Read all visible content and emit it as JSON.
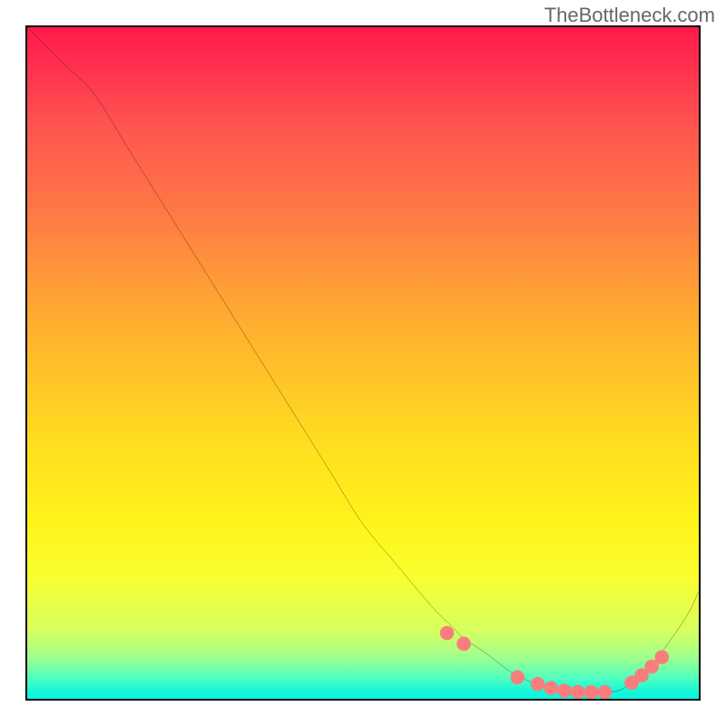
{
  "watermark": "TheBottleneck.com",
  "chart_data": {
    "type": "line",
    "title": "",
    "xlabel": "",
    "ylabel": "",
    "xlim": [
      0,
      100
    ],
    "ylim": [
      0,
      100
    ],
    "curve": {
      "name": "bottleneck-curve",
      "x": [
        0,
        5,
        10,
        15,
        20,
        25,
        30,
        35,
        40,
        45,
        50,
        55,
        60,
        63,
        65,
        68,
        72,
        75,
        78,
        82,
        85,
        88,
        90,
        93,
        98,
        100
      ],
      "y": [
        100,
        95,
        90,
        82,
        74,
        66,
        58,
        50,
        42,
        34,
        26,
        20,
        14,
        11,
        9,
        7,
        4,
        2.5,
        1.5,
        1.0,
        1.0,
        1.2,
        2.5,
        5,
        12,
        16
      ]
    },
    "markers": {
      "name": "highlight-dots",
      "color": "#f97d7d",
      "x": [
        62.5,
        65,
        73,
        76,
        78,
        80,
        82,
        84,
        86,
        90,
        91.5,
        93,
        94.5
      ],
      "y": [
        9.8,
        8.2,
        3.2,
        2.2,
        1.6,
        1.2,
        1.0,
        1.0,
        1.0,
        2.4,
        3.5,
        4.8,
        6.2
      ]
    },
    "gradient_stops": [
      {
        "pos": 0,
        "color": "#ff1a4a"
      },
      {
        "pos": 50,
        "color": "#ffd020"
      },
      {
        "pos": 100,
        "color": "#0df5e0"
      }
    ]
  }
}
